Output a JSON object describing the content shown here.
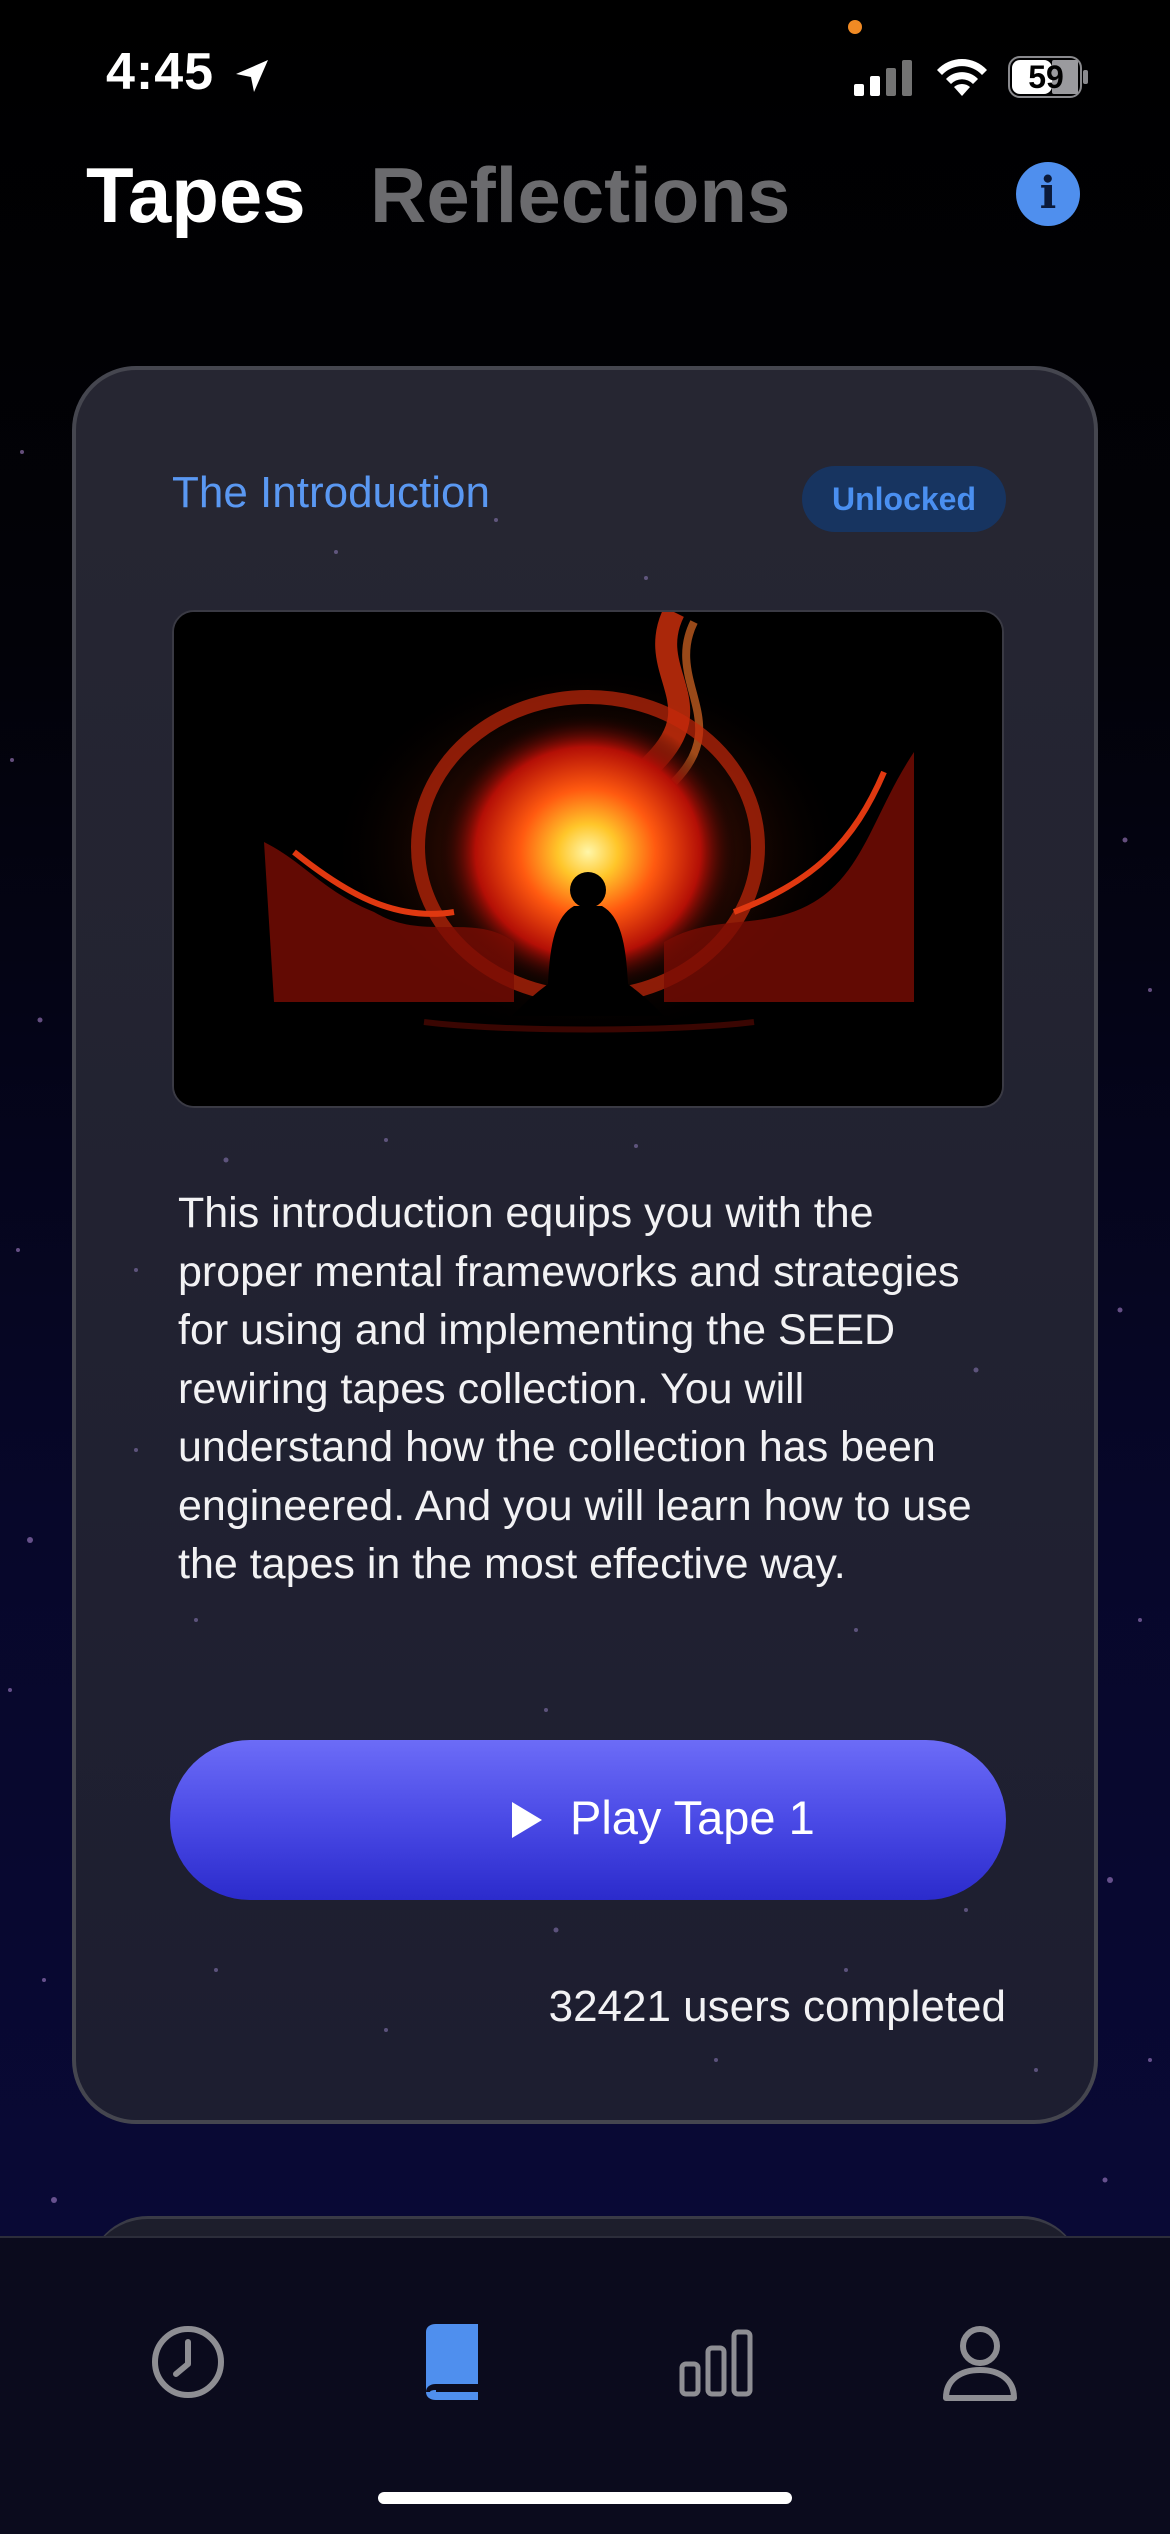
{
  "status_bar": {
    "time": "4:45",
    "battery": "59",
    "icons": [
      "location-arrow-icon",
      "signal-icon",
      "wifi-icon",
      "battery-icon"
    ]
  },
  "header": {
    "tabs": [
      {
        "label": "Tapes",
        "active": true
      },
      {
        "label": "Reflections",
        "active": false
      }
    ],
    "info_icon": "i"
  },
  "card": {
    "title": "The Introduction",
    "badge": "Unlocked",
    "description": "This introduction equips you with the proper mental frameworks and strategies for using and implementing the SEED rewiring tapes collection. You will understand how the collection has been engineered. And you will learn how to use the tapes in the most effective way.",
    "play_button": "Play Tape 1",
    "completed_text": "32421 users completed"
  },
  "tab_bar": {
    "items": [
      {
        "icon": "clock-icon",
        "active": false
      },
      {
        "icon": "book-icon",
        "active": true
      },
      {
        "icon": "bar-chart-icon",
        "active": false
      },
      {
        "icon": "profile-icon",
        "active": false
      }
    ]
  },
  "colors": {
    "accent": "#5a98f2",
    "button_top": "#6c6cf7",
    "button_bottom": "#2b2bcc",
    "inactive": "#8e8e93"
  }
}
